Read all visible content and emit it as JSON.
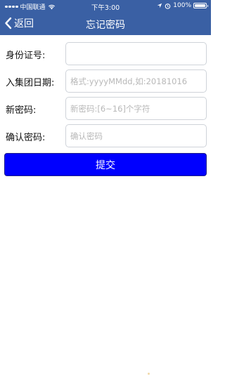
{
  "status_bar": {
    "carrier": "中国联通",
    "time": "下午3:00",
    "battery": "100%"
  },
  "nav": {
    "back_label": "返回",
    "title": "忘记密码"
  },
  "form": {
    "fields": [
      {
        "label": "身份证号:",
        "value": "",
        "placeholder": ""
      },
      {
        "label": "入集团日期:",
        "value": "",
        "placeholder": "格式:yyyyMMdd,如:20181016"
      },
      {
        "label": "新密码:",
        "value": "",
        "placeholder": "新密码:[6~16]个字符"
      },
      {
        "label": "确认密码:",
        "value": "",
        "placeholder": "确认密码"
      }
    ],
    "submit_label": "提交"
  },
  "colors": {
    "header_bg": "#3a60a4",
    "submit_bg": "#0000ff"
  }
}
